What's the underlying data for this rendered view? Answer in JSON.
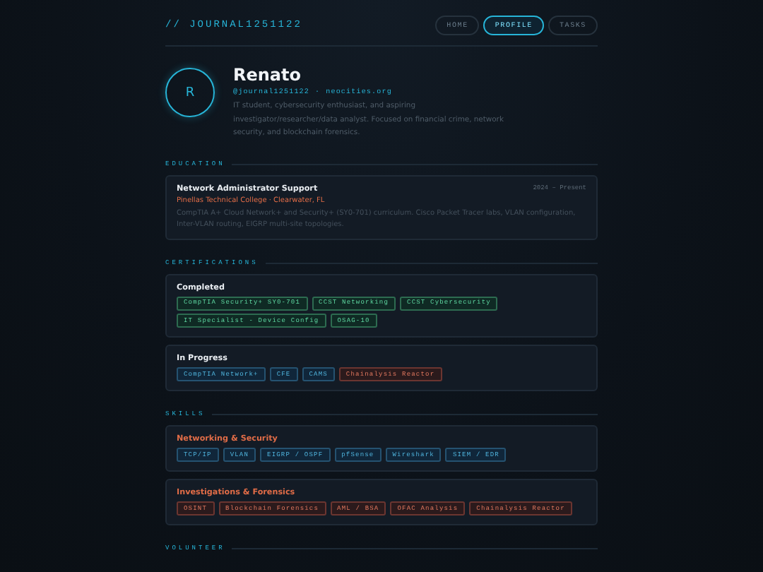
{
  "header": {
    "logo": "// JOURNAL1251122",
    "nav": [
      {
        "label": "HOME",
        "selected": false
      },
      {
        "label": "PROFILE",
        "selected": true
      },
      {
        "label": "TASKS",
        "selected": false
      }
    ]
  },
  "profile": {
    "initial": "R",
    "name": "Renato",
    "handle": "@journal1251122",
    "separator": "·",
    "site": "neocities.org",
    "bio": "IT student, cybersecurity enthusiast, and aspiring investigator/researcher/data analyst. Focused on financial crime, network security, and blockchain forensics."
  },
  "sections": [
    {
      "title": "EDUCATION",
      "cards": [
        {
          "kind": "entry",
          "title": "Network Administrator Support",
          "date": "2024 – Present",
          "subtitle": "Pinellas Technical College · Clearwater, FL",
          "text": "CompTIA A+ Cloud Network+ and Security+ (SY0-701) curriculum. Cisco Packet Tracer labs, VLAN configuration, Inter-VLAN routing, EIGRP multi-site topologies."
        }
      ]
    },
    {
      "title": "CERTIFICATIONS",
      "cards": [
        {
          "kind": "tags",
          "title": "Completed",
          "accent": false,
          "tags": [
            {
              "label": "CompTIA Security+ SY0-701",
              "kind": "done"
            },
            {
              "label": "CCST Networking",
              "kind": "done"
            },
            {
              "label": "CCST Cybersecurity",
              "kind": "done"
            },
            {
              "label": "IT Specialist - Device Config",
              "kind": "done"
            },
            {
              "label": "OSAG-10",
              "kind": "done"
            }
          ]
        },
        {
          "kind": "tags",
          "title": "In Progress",
          "accent": false,
          "tags": [
            {
              "label": "CompTIA Network+",
              "kind": "active"
            },
            {
              "label": "CFE",
              "kind": "active"
            },
            {
              "label": "CAMS",
              "kind": "active"
            },
            {
              "label": "Chainalysis Reactor",
              "kind": "alert"
            }
          ]
        }
      ]
    },
    {
      "title": "SKILLS",
      "cards": [
        {
          "kind": "tags",
          "title": "Networking & Security",
          "accent": true,
          "tags": [
            {
              "label": "TCP/IP",
              "kind": "active"
            },
            {
              "label": "VLAN",
              "kind": "active"
            },
            {
              "label": "EIGRP / OSPF",
              "kind": "active"
            },
            {
              "label": "pfSense",
              "kind": "active"
            },
            {
              "label": "Wireshark",
              "kind": "active"
            },
            {
              "label": "SIEM / EDR",
              "kind": "active"
            }
          ]
        },
        {
          "kind": "tags",
          "title": "Investigations & Forensics",
          "accent": true,
          "tags": [
            {
              "label": "OSINT",
              "kind": "alert"
            },
            {
              "label": "Blockchain Forensics",
              "kind": "alert"
            },
            {
              "label": "AML / BSA",
              "kind": "alert"
            },
            {
              "label": "OFAC Analysis",
              "kind": "alert"
            },
            {
              "label": "Chainalysis Reactor",
              "kind": "alert"
            }
          ]
        }
      ]
    },
    {
      "title": "VOLUNTEER"
    }
  ]
}
